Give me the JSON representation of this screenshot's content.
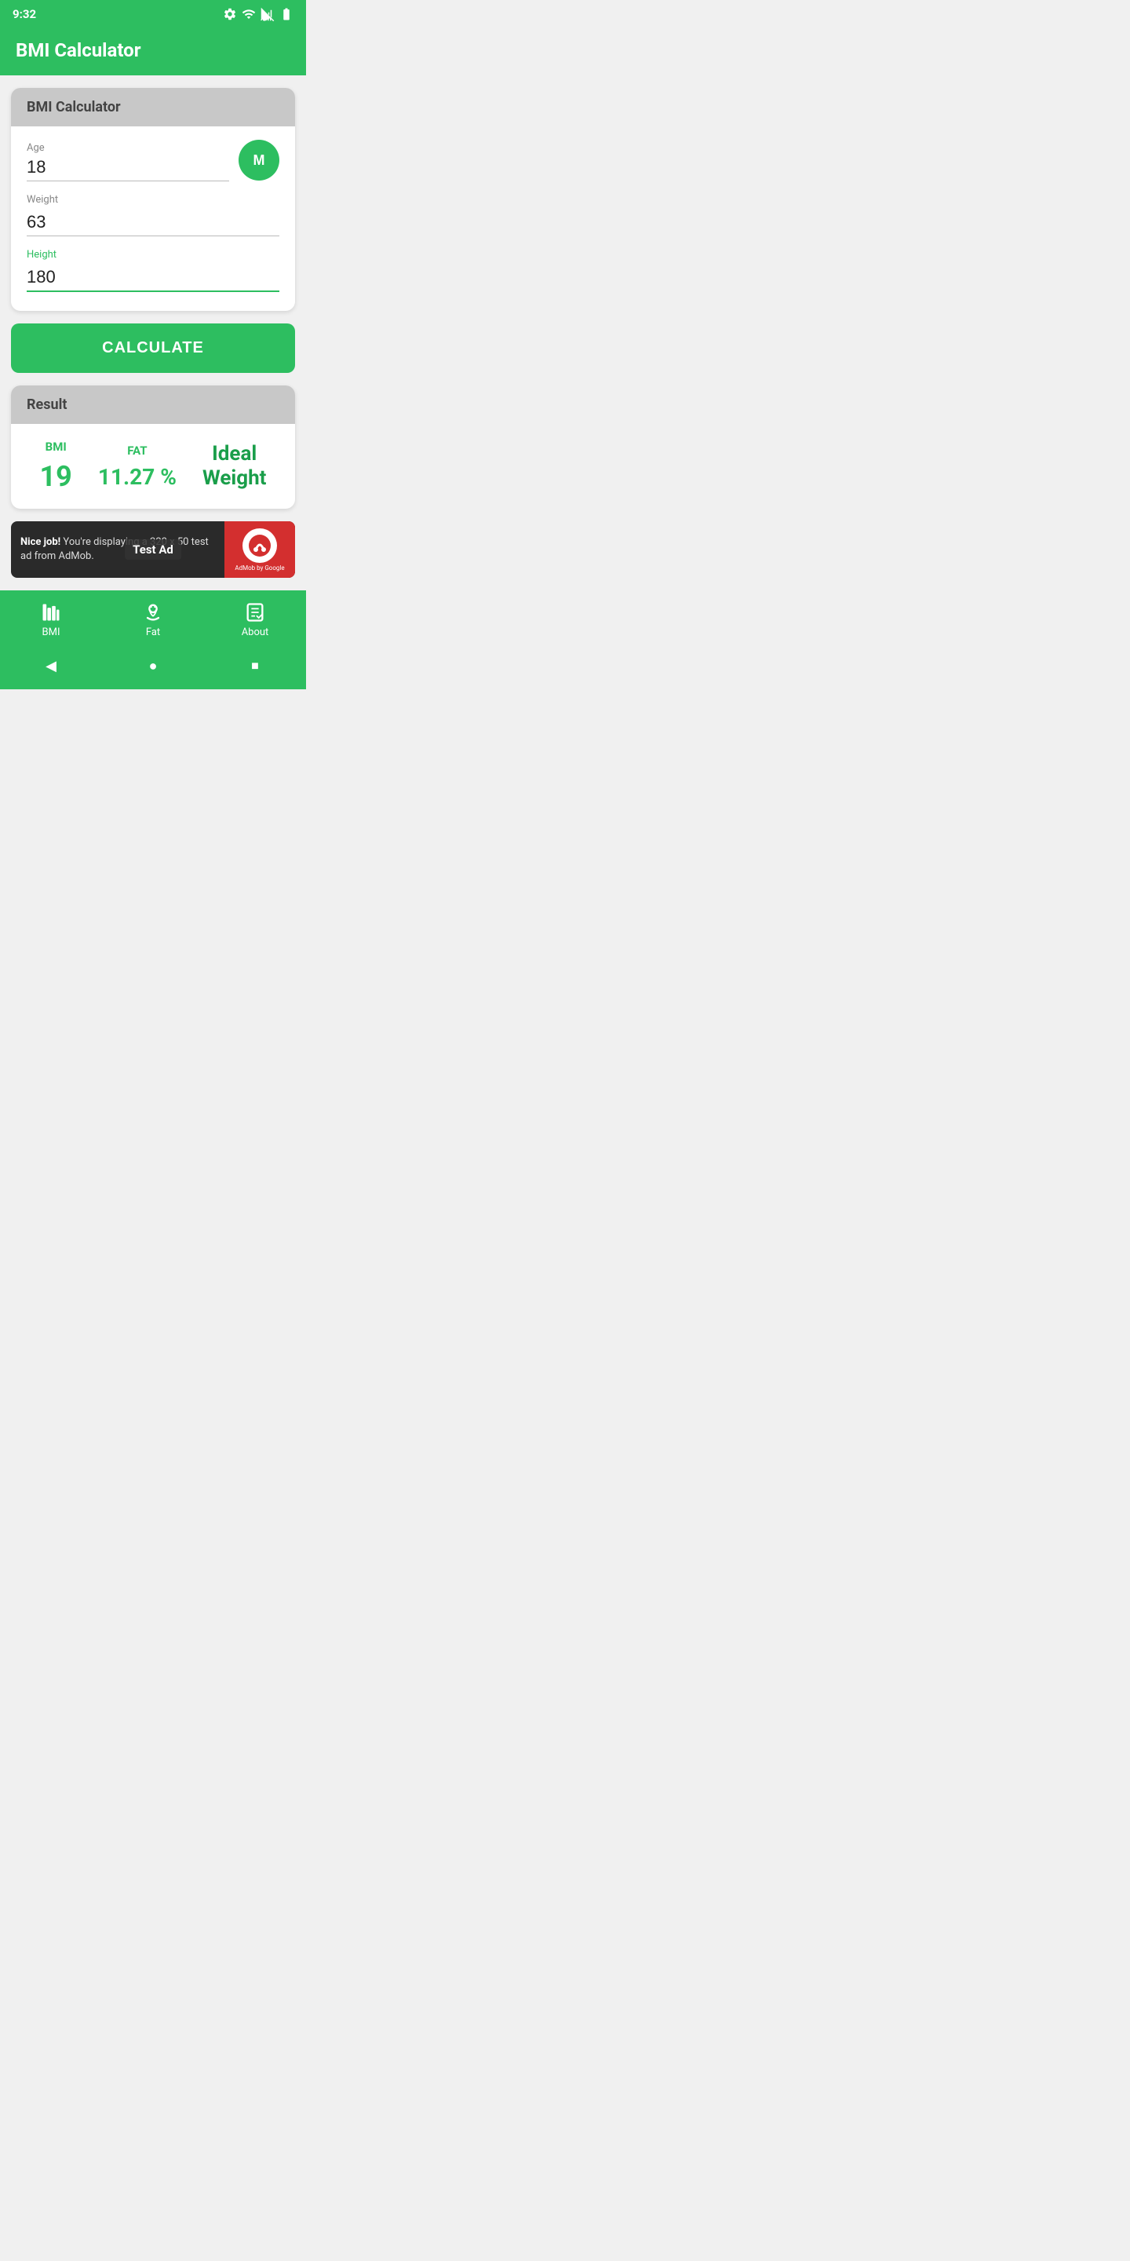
{
  "status": {
    "time": "9:32",
    "icons": [
      "settings",
      "wifi",
      "signal",
      "battery"
    ]
  },
  "appbar": {
    "title": "BMI Calculator"
  },
  "calculator_card": {
    "header": "BMI Calculator",
    "age_label": "Age",
    "age_value": "18",
    "gender_label": "M",
    "weight_label": "Weight",
    "weight_value": "63",
    "height_label": "Height",
    "height_value": "180"
  },
  "calculate_button": {
    "label": "CALCULATE"
  },
  "result_card": {
    "header": "Result",
    "bmi_label": "BMI",
    "bmi_value": "19",
    "fat_label": "FAT",
    "fat_value": "11.27 %",
    "ideal_label": "Ideal\nWeight"
  },
  "ad": {
    "strong": "Nice job!",
    "text": " You're displaying a 320 x 50 test ad from AdMob.",
    "badge": "Test Ad",
    "logo_text": "AdMob by Google"
  },
  "bottom_nav": {
    "items": [
      {
        "id": "bmi",
        "label": "BMI",
        "active": true
      },
      {
        "id": "fat",
        "label": "Fat",
        "active": false
      },
      {
        "id": "about",
        "label": "About",
        "active": false
      }
    ]
  },
  "sys_nav": {
    "back": "◀",
    "home": "●",
    "recent": "■"
  }
}
